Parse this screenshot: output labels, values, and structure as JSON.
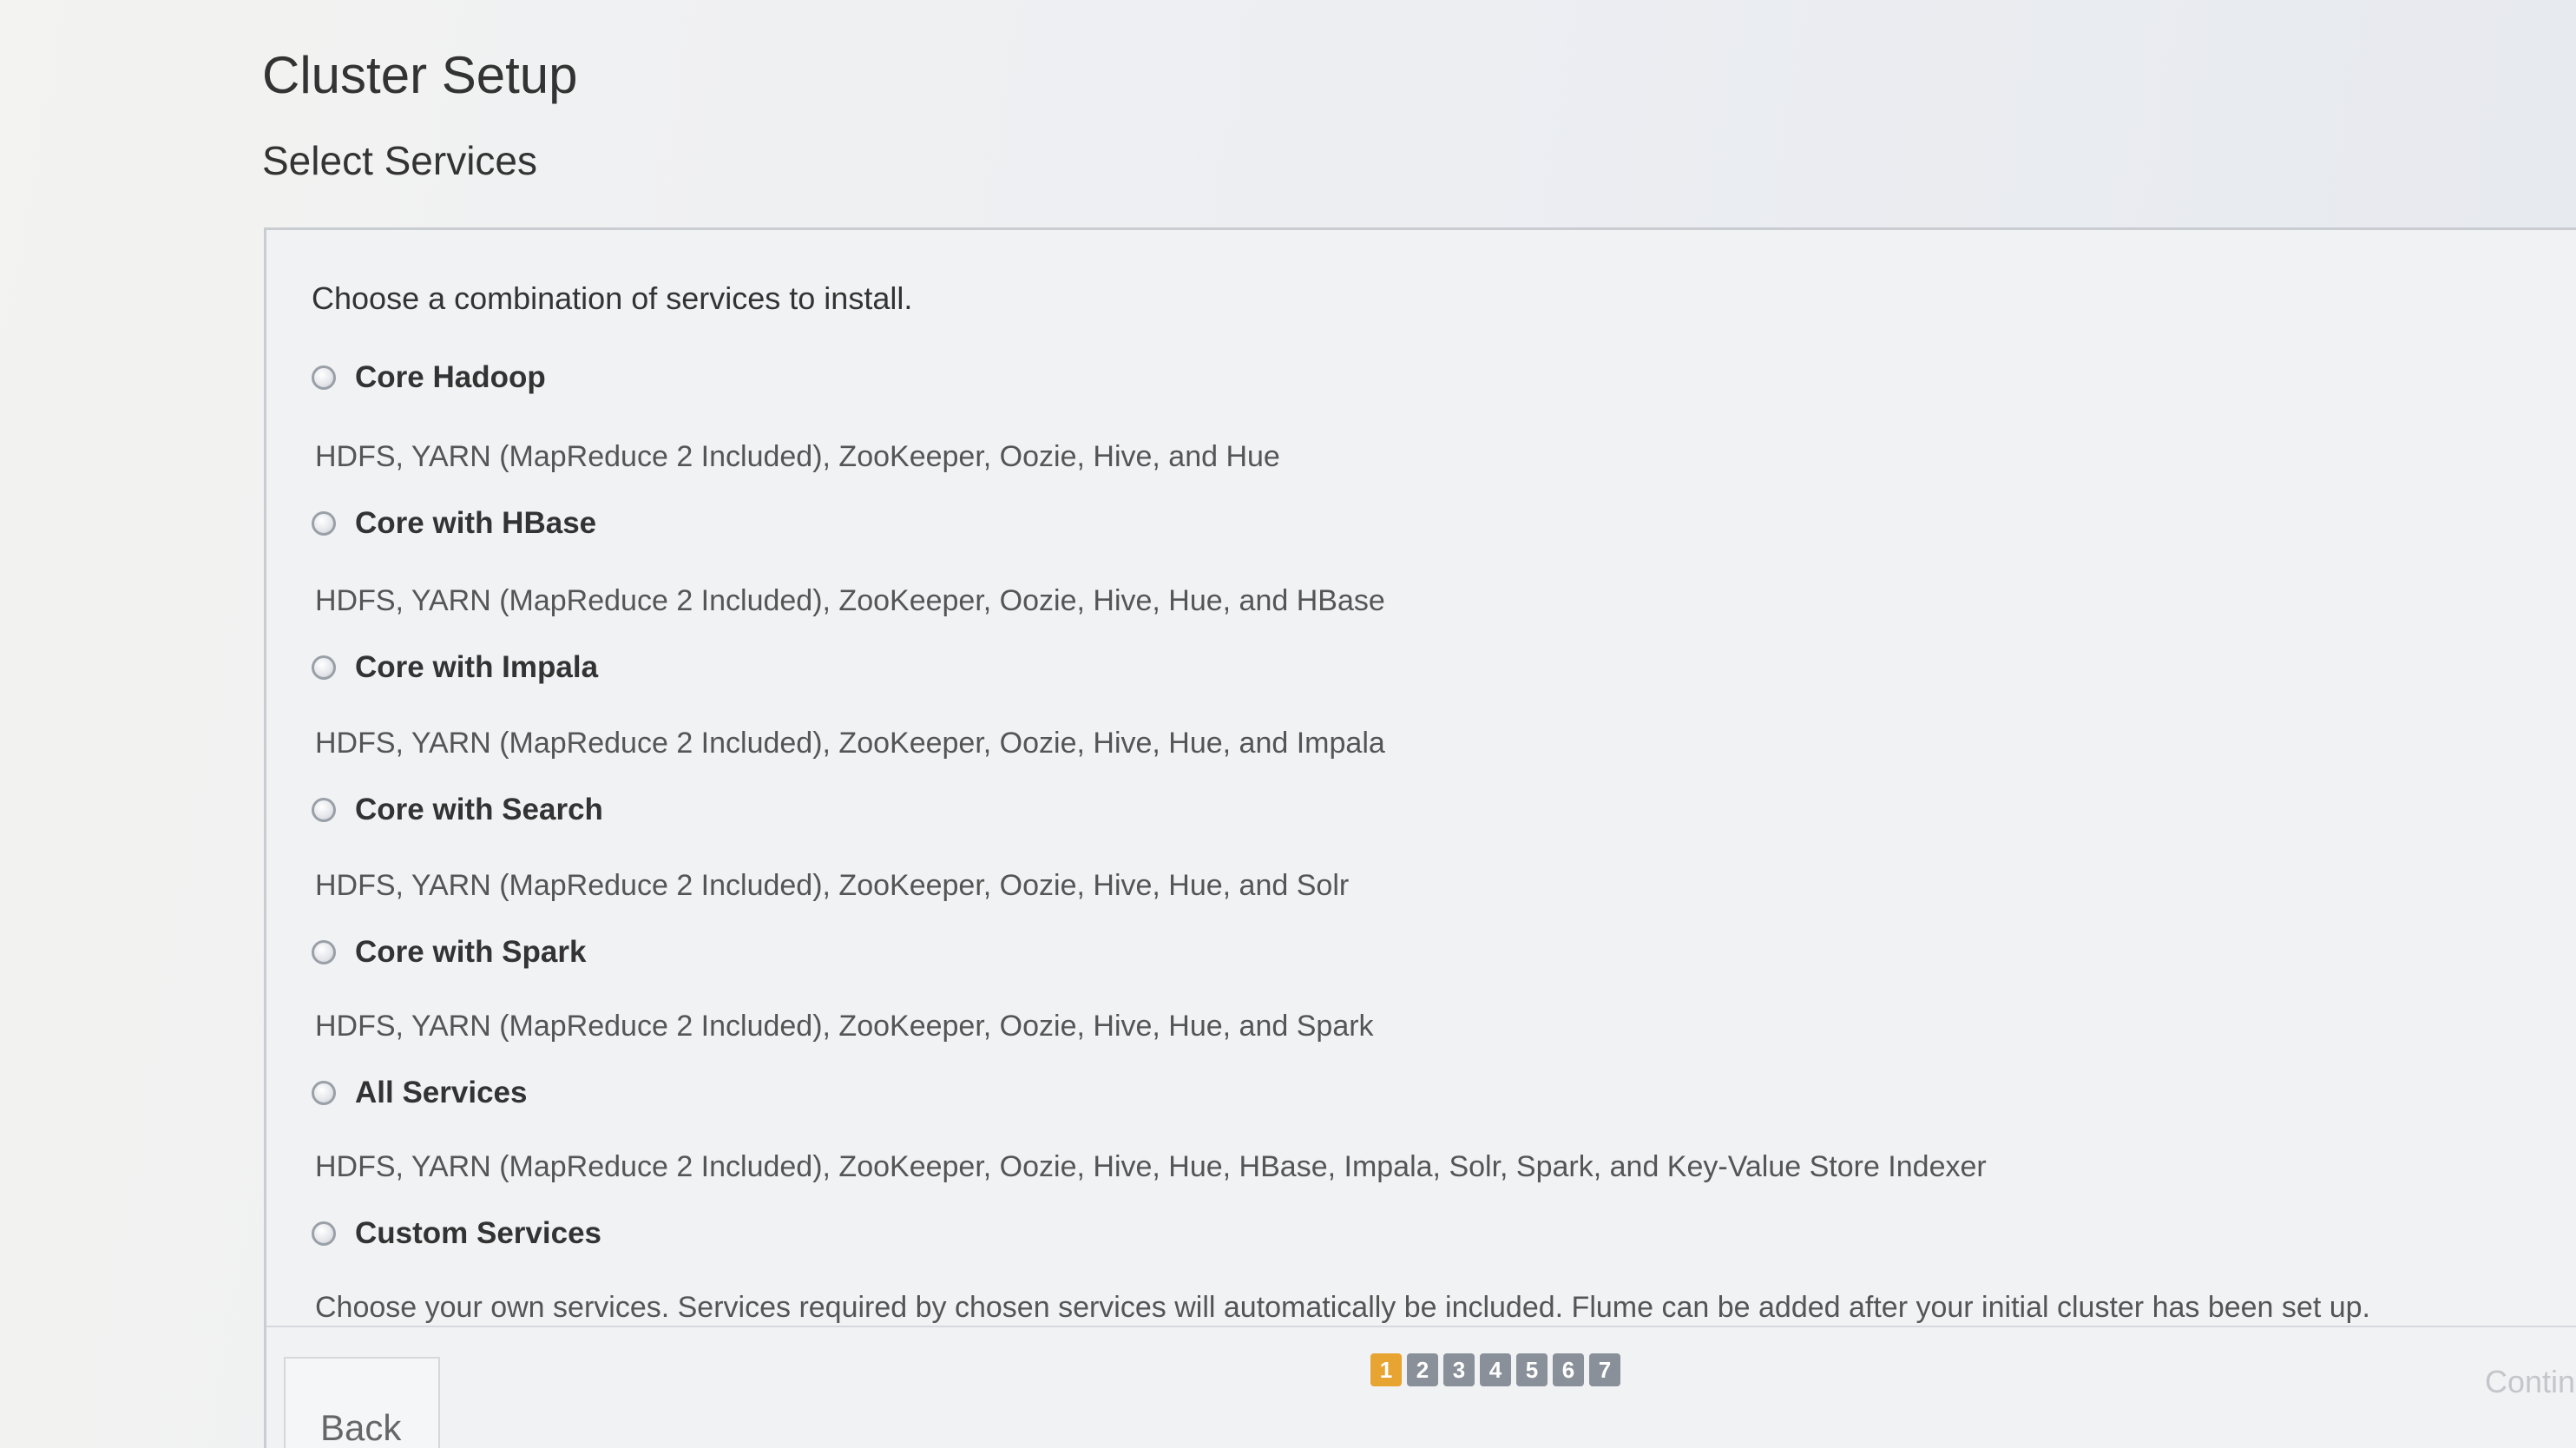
{
  "header": {
    "title": "Cluster Setup",
    "subtitle": "Select Services"
  },
  "main": {
    "intro": "Choose a combination of services to install.",
    "options": [
      {
        "label": "Core Hadoop",
        "description": "HDFS, YARN (MapReduce 2 Included), ZooKeeper, Oozie, Hive, and Hue"
      },
      {
        "label": "Core with HBase",
        "description": "HDFS, YARN (MapReduce 2 Included), ZooKeeper, Oozie, Hive, Hue, and HBase"
      },
      {
        "label": "Core with Impala",
        "description": "HDFS, YARN (MapReduce 2 Included), ZooKeeper, Oozie, Hive, Hue, and Impala"
      },
      {
        "label": "Core with Search",
        "description": "HDFS, YARN (MapReduce 2 Included), ZooKeeper, Oozie, Hive, Hue, and Solr"
      },
      {
        "label": "Core with Spark",
        "description": "HDFS, YARN (MapReduce 2 Included), ZooKeeper, Oozie, Hive, Hue, and Spark"
      },
      {
        "label": "All Services",
        "description": "HDFS, YARN (MapReduce 2 Included), ZooKeeper, Oozie, Hive, Hue, HBase, Impala, Solr, Spark, and Key-Value Store Indexer"
      },
      {
        "label": "Custom Services",
        "description": "Choose your own services. Services required by chosen services will automatically be included. Flume can be added after your initial cluster has been set up."
      }
    ]
  },
  "footer": {
    "back_label": "Back",
    "steps": [
      "1",
      "2",
      "3",
      "4",
      "5",
      "6",
      "7"
    ],
    "current_step": "1",
    "continue_label": "Contin"
  },
  "colors": {
    "active_step": "#e8a430",
    "inactive_step": "#8a9099"
  }
}
